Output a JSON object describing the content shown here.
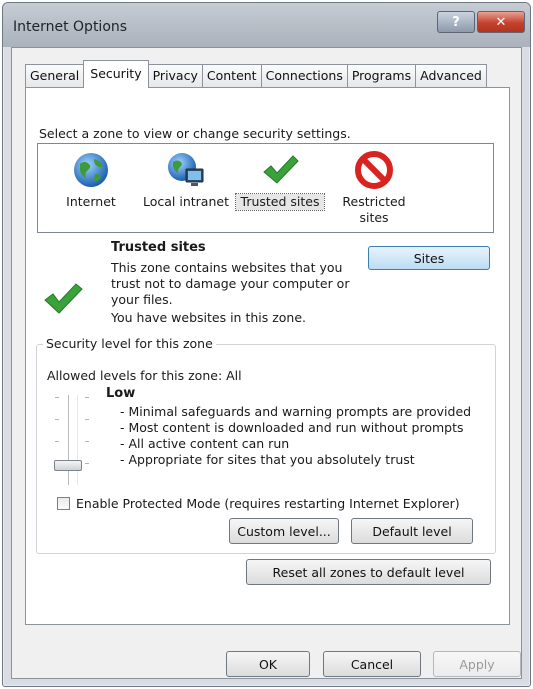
{
  "window": {
    "title": "Internet Options",
    "help_symbol": "?",
    "close_symbol": "✕"
  },
  "tabs": [
    {
      "label": "General"
    },
    {
      "label": "Security"
    },
    {
      "label": "Privacy"
    },
    {
      "label": "Content"
    },
    {
      "label": "Connections"
    },
    {
      "label": "Programs"
    },
    {
      "label": "Advanced"
    }
  ],
  "active_tab": "Security",
  "security": {
    "zone_prompt": "Select a zone to view or change security settings.",
    "zones": [
      {
        "label": "Internet",
        "icon": "globe-icon"
      },
      {
        "label": "Local intranet",
        "icon": "intranet-icon"
      },
      {
        "label": "Trusted sites",
        "icon": "checkmark-icon"
      },
      {
        "label": "Restricted sites",
        "icon": "restricted-icon"
      }
    ],
    "selected_zone": "Trusted sites",
    "zone_title": "Trusted sites",
    "zone_description": "This zone contains websites that you trust not to damage your computer or your files.",
    "zone_status": "You have websites in this zone.",
    "sites_button": "Sites",
    "group_title": "Security level for this zone",
    "allowed_levels": "Allowed levels for this zone: All",
    "level_name": "Low",
    "level_details": [
      "- Minimal safeguards and warning prompts are provided",
      "- Most content is downloaded and run without prompts",
      "- All active content can run",
      "- Appropriate for sites that you absolutely trust"
    ],
    "protected_mode_label": "Enable Protected Mode (requires restarting Internet Explorer)",
    "protected_mode_checked": false,
    "custom_level_button": "Custom level...",
    "default_level_button": "Default level",
    "reset_all_button": "Reset all zones to default level"
  },
  "footer": {
    "ok": "OK",
    "cancel": "Cancel",
    "apply": "Apply"
  },
  "colors": {
    "accent_check": "#3aa23a",
    "restricted_red": "#d8231f",
    "selection_blue": "#3c7fb1"
  }
}
